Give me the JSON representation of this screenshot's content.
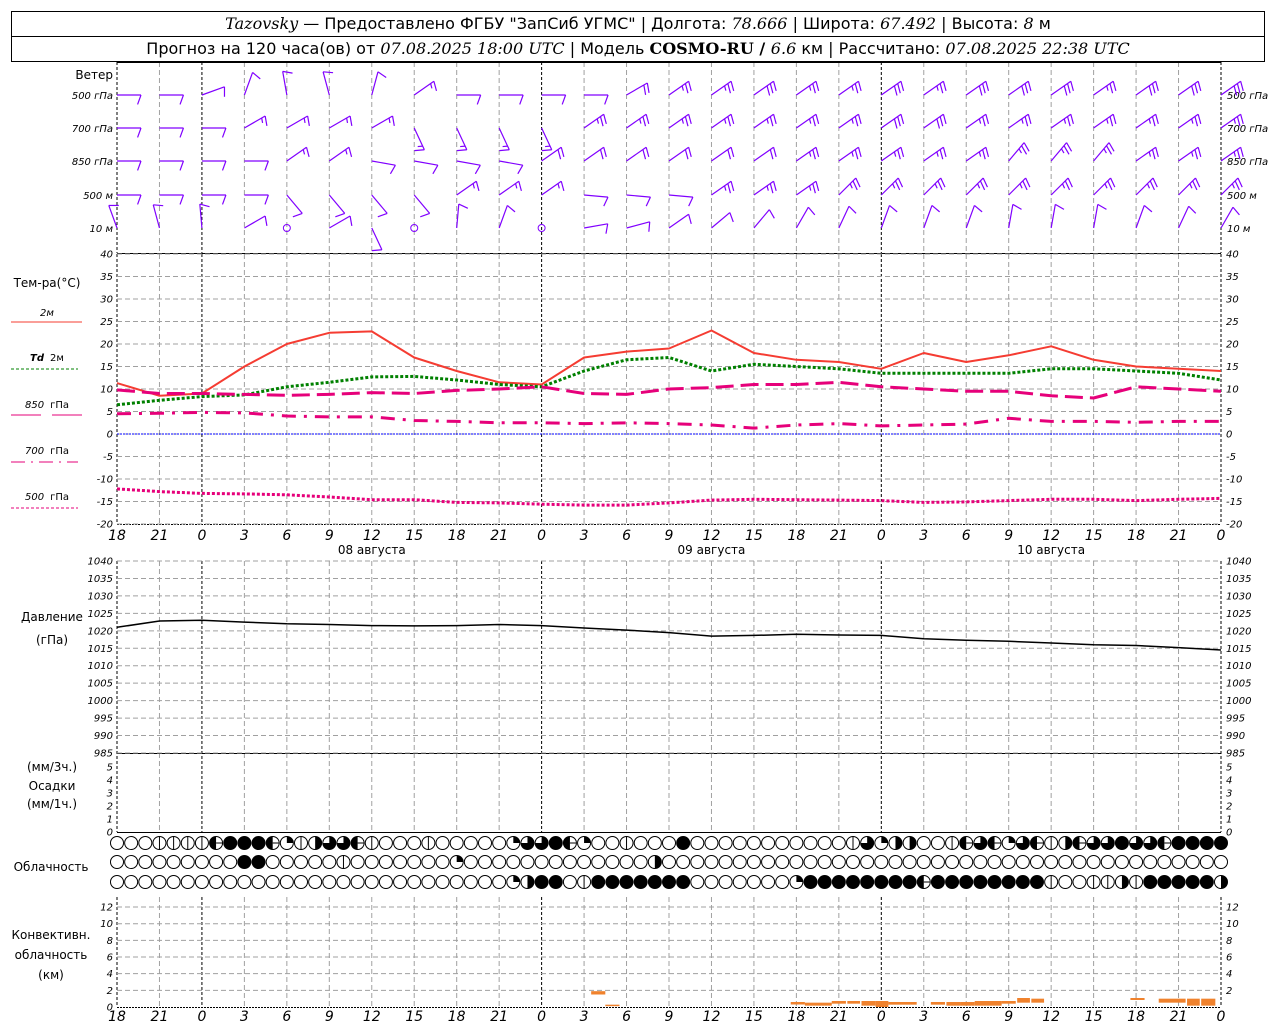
{
  "header": {
    "station": "Tazovsky",
    "provider": " — Предоставлено ФГБУ \"ЗапСиб УГМС\" | ",
    "lon_label": "Долгота: ",
    "lon": "78.666",
    "lat_label": " | Широта: ",
    "lat": "67.492",
    "alt_label": " | Высота: ",
    "alt": "8",
    "alt_unit": "м",
    "forecast_label": "Прогноз на 120 часа(ов) от ",
    "forecast_start": "07.08.2025 18:00 UTC",
    "model_label": "  | Модель ",
    "model": "COSMO-RU / ",
    "resolution": "6.6",
    "res_unit": "км",
    "calc_label": " | Рассчитано: ",
    "calc_time": "07.08.2025 22:38 UTC"
  },
  "colors": {
    "wind": "#8000ff",
    "t2m": "#f53c32",
    "td2m": "#008000",
    "t850": "#e6007a",
    "t700": "#e6007a",
    "t500": "#e6007a",
    "zero_line": "#0000ff",
    "convective": "#f0822d",
    "grid": "#a0a0a0"
  },
  "x_axis": {
    "hours_from_start": [
      0,
      3,
      6,
      9,
      12,
      15,
      18,
      21,
      24,
      27,
      30,
      33,
      36,
      39,
      42,
      45,
      48,
      51,
      54,
      57,
      60,
      63,
      66,
      69,
      72,
      75,
      78
    ],
    "tick_labels": [
      "18",
      "21",
      "0",
      "3",
      "6",
      "9",
      "12",
      "15",
      "18",
      "21",
      "0",
      "3",
      "6",
      "9",
      "12",
      "15",
      "18",
      "21",
      "0",
      "3",
      "6",
      "9",
      "12",
      "15",
      "18",
      "21",
      "0"
    ],
    "dates": [
      "08 августа",
      "09 августа",
      "10 августа"
    ]
  },
  "chart_data": [
    {
      "type": "wind_barbs",
      "title": "Ветер",
      "levels": [
        {
          "name": "500 гПа",
          "values": [
            [
              90,
              5
            ],
            [
              90,
              5
            ],
            [
              70,
              5
            ],
            [
              20,
              5
            ],
            [
              350,
              5
            ],
            [
              345,
              5
            ],
            [
              15,
              5
            ],
            [
              55,
              7.5
            ],
            [
              90,
              5
            ],
            [
              90,
              5
            ],
            [
              90,
              5
            ],
            [
              90,
              5
            ],
            [
              60,
              10
            ],
            [
              55,
              12.5
            ],
            [
              55,
              12.5
            ],
            [
              55,
              15
            ],
            [
              55,
              12.5
            ],
            [
              55,
              12.5
            ],
            [
              55,
              15
            ],
            [
              55,
              12.5
            ],
            [
              55,
              15
            ],
            [
              55,
              15
            ],
            [
              55,
              15
            ],
            [
              55,
              12.5
            ],
            [
              55,
              15
            ],
            [
              55,
              15
            ],
            [
              55,
              15
            ]
          ]
        },
        {
          "name": "700 гПа",
          "values": [
            [
              90,
              5
            ],
            [
              90,
              5
            ],
            [
              90,
              5
            ],
            [
              60,
              7.5
            ],
            [
              60,
              7.5
            ],
            [
              60,
              7.5
            ],
            [
              60,
              7.5
            ],
            [
              155,
              7.5
            ],
            [
              155,
              7.5
            ],
            [
              155,
              7.5
            ],
            [
              155,
              7.5
            ],
            [
              55,
              12.5
            ],
            [
              55,
              12.5
            ],
            [
              55,
              12.5
            ],
            [
              55,
              12.5
            ],
            [
              55,
              12.5
            ],
            [
              55,
              12.5
            ],
            [
              55,
              12.5
            ],
            [
              55,
              15
            ],
            [
              55,
              15
            ],
            [
              55,
              12.5
            ],
            [
              55,
              12.5
            ],
            [
              55,
              12.5
            ],
            [
              55,
              12.5
            ],
            [
              55,
              12.5
            ],
            [
              55,
              12.5
            ],
            [
              55,
              12.5
            ]
          ]
        },
        {
          "name": "850 гПа",
          "values": [
            [
              90,
              5
            ],
            [
              90,
              5
            ],
            [
              90,
              5
            ],
            [
              90,
              5
            ],
            [
              55,
              7.5
            ],
            [
              55,
              7.5
            ],
            [
              100,
              5
            ],
            [
              100,
              5
            ],
            [
              100,
              5
            ],
            [
              100,
              5
            ],
            [
              55,
              10
            ],
            [
              55,
              10
            ],
            [
              55,
              10
            ],
            [
              55,
              10
            ],
            [
              55,
              10
            ],
            [
              55,
              10
            ],
            [
              55,
              12.5
            ],
            [
              55,
              12.5
            ],
            [
              55,
              12.5
            ],
            [
              55,
              12.5
            ],
            [
              55,
              12.5
            ],
            [
              40,
              12.5
            ],
            [
              40,
              12.5
            ],
            [
              40,
              12.5
            ],
            [
              55,
              12.5
            ],
            [
              55,
              12.5
            ],
            [
              55,
              12.5
            ]
          ]
        },
        {
          "name": "500 м",
          "values": [
            [
              90,
              5
            ],
            [
              90,
              5
            ],
            [
              90,
              5
            ],
            [
              90,
              5
            ],
            [
              140,
              5
            ],
            [
              140,
              5
            ],
            [
              140,
              5
            ],
            [
              140,
              5
            ],
            [
              55,
              7.5
            ],
            [
              55,
              7.5
            ],
            [
              55,
              7.5
            ],
            [
              95,
              5
            ],
            [
              95,
              5
            ],
            [
              95,
              5
            ],
            [
              55,
              12.5
            ],
            [
              55,
              12.5
            ],
            [
              55,
              12.5
            ],
            [
              45,
              12.5
            ],
            [
              45,
              12.5
            ],
            [
              45,
              12.5
            ],
            [
              45,
              12.5
            ],
            [
              45,
              12.5
            ],
            [
              45,
              12.5
            ],
            [
              45,
              12.5
            ],
            [
              45,
              12.5
            ],
            [
              45,
              12.5
            ],
            [
              45,
              12.5
            ]
          ]
        },
        {
          "name": "10  м",
          "values": [
            [
              340,
              5
            ],
            [
              345,
              5
            ],
            [
              355,
              5
            ],
            [
              60,
              5
            ],
            [
              0,
              0
            ],
            [
              60,
              5
            ],
            [
              155,
              5
            ],
            [
              0,
              0
            ],
            [
              5,
              5
            ],
            [
              20,
              5
            ],
            [
              0,
              0
            ],
            [
              80,
              5
            ],
            [
              75,
              5
            ],
            [
              55,
              5
            ],
            [
              50,
              5
            ],
            [
              40,
              5
            ],
            [
              30,
              5
            ],
            [
              25,
              5
            ],
            [
              20,
              5
            ],
            [
              20,
              5
            ],
            [
              20,
              5
            ],
            [
              10,
              5
            ],
            [
              10,
              5
            ],
            [
              10,
              5
            ],
            [
              20,
              5
            ],
            [
              25,
              5
            ],
            [
              30,
              5
            ]
          ]
        }
      ]
    },
    {
      "type": "line",
      "ylabel": "Тем-ра(°C)",
      "ylim": [
        -20,
        40
      ],
      "yticks": [
        -20,
        -15,
        -10,
        -5,
        0,
        5,
        10,
        15,
        20,
        25,
        30,
        35,
        40
      ],
      "grid": true,
      "legend": "left",
      "series": [
        {
          "name": "2м",
          "key": "t2m",
          "values": [
            11.3,
            8.5,
            9,
            15,
            20,
            22.5,
            22.8,
            17,
            14,
            11.5,
            11,
            17,
            18.3,
            19,
            23,
            18,
            16.5,
            16,
            14.5,
            18,
            16,
            17.5,
            19.5,
            16.5,
            15,
            14.5,
            14
          ]
        },
        {
          "name": "Td",
          "name_suffix": "2м",
          "key": "td2m",
          "values": [
            6.5,
            7.5,
            8.3,
            8.7,
            10.5,
            11.5,
            12.7,
            12.8,
            12,
            11,
            10.5,
            14,
            16.5,
            17,
            14,
            15.5,
            15,
            14.5,
            13.5,
            13.5,
            13.5,
            13.5,
            14.5,
            14.5,
            14,
            13.5,
            12
          ]
        },
        {
          "name": "850",
          "name_suffix": "гПа",
          "key": "t850",
          "values": [
            9.8,
            9,
            9,
            8.8,
            8.6,
            8.8,
            9.2,
            9,
            9.7,
            10,
            10.5,
            9,
            8.8,
            10,
            10.3,
            11,
            11,
            11.5,
            10.5,
            10,
            9.5,
            9.5,
            8.5,
            8,
            10.5,
            10,
            9.5
          ]
        },
        {
          "name": "700",
          "name_suffix": "гПа",
          "key": "t700",
          "values": [
            4.5,
            4.6,
            4.8,
            4.7,
            4,
            3.8,
            3.8,
            3,
            2.8,
            2.5,
            2.5,
            2.3,
            2.5,
            2.3,
            2,
            1.3,
            2,
            2.3,
            1.8,
            2,
            2.2,
            3.5,
            2.8,
            2.8,
            2.6,
            2.8,
            2.8
          ]
        },
        {
          "name": "500",
          "name_suffix": "гПа",
          "key": "t500",
          "values": [
            -12.2,
            -12.8,
            -13.2,
            -13.3,
            -13.5,
            -14,
            -14.6,
            -14.6,
            -15.2,
            -15.3,
            -15.6,
            -15.8,
            -15.8,
            -15.3,
            -14.7,
            -14.5,
            -14.6,
            -14.7,
            -14.8,
            -15.2,
            -15.1,
            -14.8,
            -14.5,
            -14.5,
            -14.8,
            -14.5,
            -14.3
          ]
        }
      ]
    },
    {
      "type": "line",
      "ylabel": "Давление",
      "yunit": "(гПа)",
      "ylim": [
        985,
        1040
      ],
      "yticks": [
        985,
        990,
        995,
        1000,
        1005,
        1010,
        1015,
        1020,
        1025,
        1030,
        1035,
        1040
      ],
      "grid": true,
      "values": [
        1021,
        1022.8,
        1023,
        1022.5,
        1022,
        1021.8,
        1021.5,
        1021.4,
        1021.5,
        1021.8,
        1021.5,
        1020.8,
        1020.2,
        1019.5,
        1018.5,
        1018.7,
        1019,
        1018.8,
        1018.7,
        1017.7,
        1017.3,
        1017,
        1016.5,
        1016,
        1015.8,
        1015.2,
        1014.5
      ]
    },
    {
      "type": "bar",
      "ylabel_top": "(мм/3ч.)",
      "ylabel": "Осадки",
      "ylabel_bottom": "(мм/1ч.)",
      "ylim": [
        0,
        5
      ],
      "yticks": [
        0,
        1,
        2,
        3,
        4,
        5
      ],
      "values": []
    },
    {
      "type": "table",
      "label": "Облачность",
      "rows": [
        "0001111588852146651000100000266852001000800000000000162440015652651456686658888",
        "0000000008800000100000002000000000000040000000000000000000000000000000000000000",
        "0000000000000000000000000000248801888888800000002888888885888888881001141888884"
      ]
    },
    {
      "type": "bar",
      "ylabel": "Конвективн.",
      "ylabel2": "облачность",
      "yunit": "(км)",
      "ylim": [
        0,
        13
      ],
      "yticks": [
        0,
        2,
        4,
        6,
        8,
        10,
        12
      ],
      "bars": [
        [
          33.5,
          34.5,
          1.5,
          1.9
        ],
        [
          34.5,
          35.5,
          0.16,
          0.28
        ],
        [
          47.6,
          48.6,
          0.3,
          0.6
        ],
        [
          48.6,
          50.5,
          0.16,
          0.52
        ],
        [
          50.5,
          51.5,
          0.4,
          0.72
        ],
        [
          51.6,
          52.5,
          0.4,
          0.72
        ],
        [
          52.6,
          53.6,
          0.16,
          0.72
        ],
        [
          53.6,
          54.5,
          0,
          0.72
        ],
        [
          54.5,
          56.5,
          0.28,
          0.6
        ],
        [
          57.5,
          58.5,
          0.28,
          0.6
        ],
        [
          58.6,
          59.6,
          0.16,
          0.6
        ],
        [
          59.6,
          60.6,
          0.16,
          0.6
        ],
        [
          60.6,
          62.5,
          0.16,
          0.72
        ],
        [
          62.5,
          63.5,
          0.4,
          0.72
        ],
        [
          63.6,
          64.5,
          0.52,
          1.08
        ],
        [
          64.6,
          65.5,
          0.52,
          1.0
        ],
        [
          71.6,
          72.6,
          0.84,
          1.08
        ],
        [
          73.6,
          75.5,
          0.52,
          1.0
        ],
        [
          75.6,
          76.5,
          0.16,
          1.0
        ],
        [
          76.6,
          77.6,
          0.16,
          1.0
        ]
      ]
    }
  ]
}
